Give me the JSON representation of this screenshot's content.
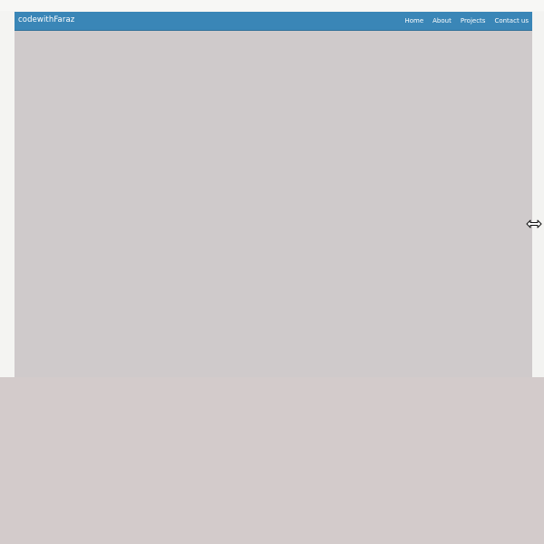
{
  "navbar": {
    "brand": "codewithFaraz",
    "links": [
      "Home",
      "About",
      "Projects",
      "Contact us"
    ]
  },
  "icons": {
    "cursor": "horizontal-resize-cursor-icon"
  },
  "colors": {
    "navbar_background": "#3a86b7",
    "page_background": "#cfcacb",
    "bottom_background": "#d3cbcb",
    "outer_background": "#f4f4f2",
    "nav_text": "#ffffff"
  }
}
